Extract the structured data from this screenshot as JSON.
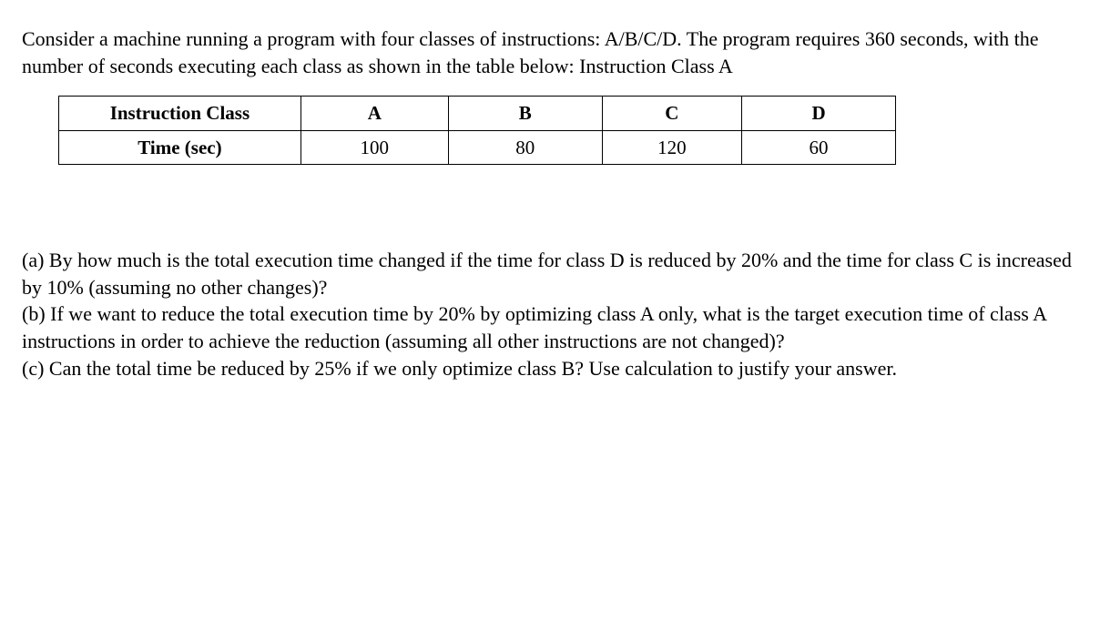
{
  "intro": "Consider a machine running a program with four classes of instructions: A/B/C/D. The program requires 360 seconds, with the number of seconds executing each class as shown in the table below: Instruction Class A",
  "table": {
    "header_row_label": "Instruction Class",
    "data_row_label": "Time (sec)",
    "columns": [
      "A",
      "B",
      "C",
      "D"
    ],
    "values": [
      "100",
      "80",
      "120",
      "60"
    ]
  },
  "questions": {
    "a": "(a) By how much is the total execution time changed if the time for class D is reduced by 20% and the time for class C is increased by 10% (assuming no other changes)?",
    "b": "(b) If we want to reduce the total execution time by 20% by optimizing class A only, what is the target execution time of class A instructions in order to achieve the reduction (assuming all other instructions are not changed)?",
    "c": "(c) Can the total time be reduced by 25% if we only optimize class B? Use calculation to justify your answer."
  }
}
